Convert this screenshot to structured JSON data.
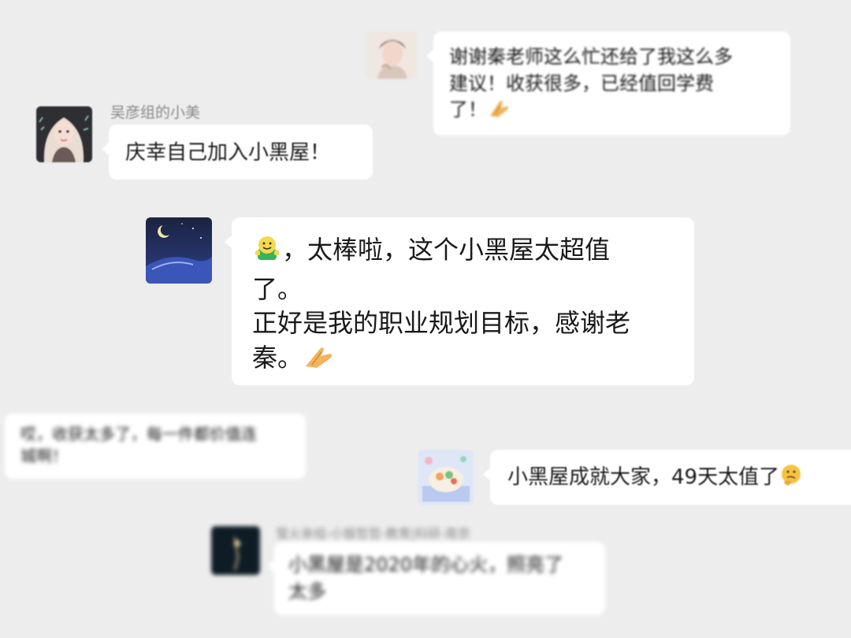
{
  "messages": [
    {
      "id": "m1",
      "sender": "",
      "lines": [
        "谢谢秦老师这么忙还给了我这么多",
        "建议！收获很多，已经值回学费",
        "了！"
      ],
      "emoji": "pray-hands-icon"
    },
    {
      "id": "m2",
      "sender": "吴彦组的小美",
      "lines": [
        "庆幸自己加入小黑屋！"
      ]
    },
    {
      "id": "m3",
      "sender": "",
      "line1_prefix_emoji": "green-smiley-icon",
      "lines": [
        "，太棒啦，这个小黑屋太超值",
        "了。",
        "正好是我的职业规划目标，感谢老",
        "秦。"
      ],
      "emoji": "pray-hands-icon"
    },
    {
      "id": "m4",
      "sender": "",
      "lines": [
        "哎，收获太多了，每一件都价值连",
        "城啊！"
      ]
    },
    {
      "id": "m5",
      "sender": "",
      "lines": [
        "小黑屋成就大家，49天太值了"
      ],
      "emoji": "thinking-face-icon"
    },
    {
      "id": "m6",
      "sender": "萤火亲组-小猴哲哲-教育|科研-南京",
      "lines": [
        "小黑屋是2020年的心火，照亮了",
        "太多"
      ]
    }
  ]
}
